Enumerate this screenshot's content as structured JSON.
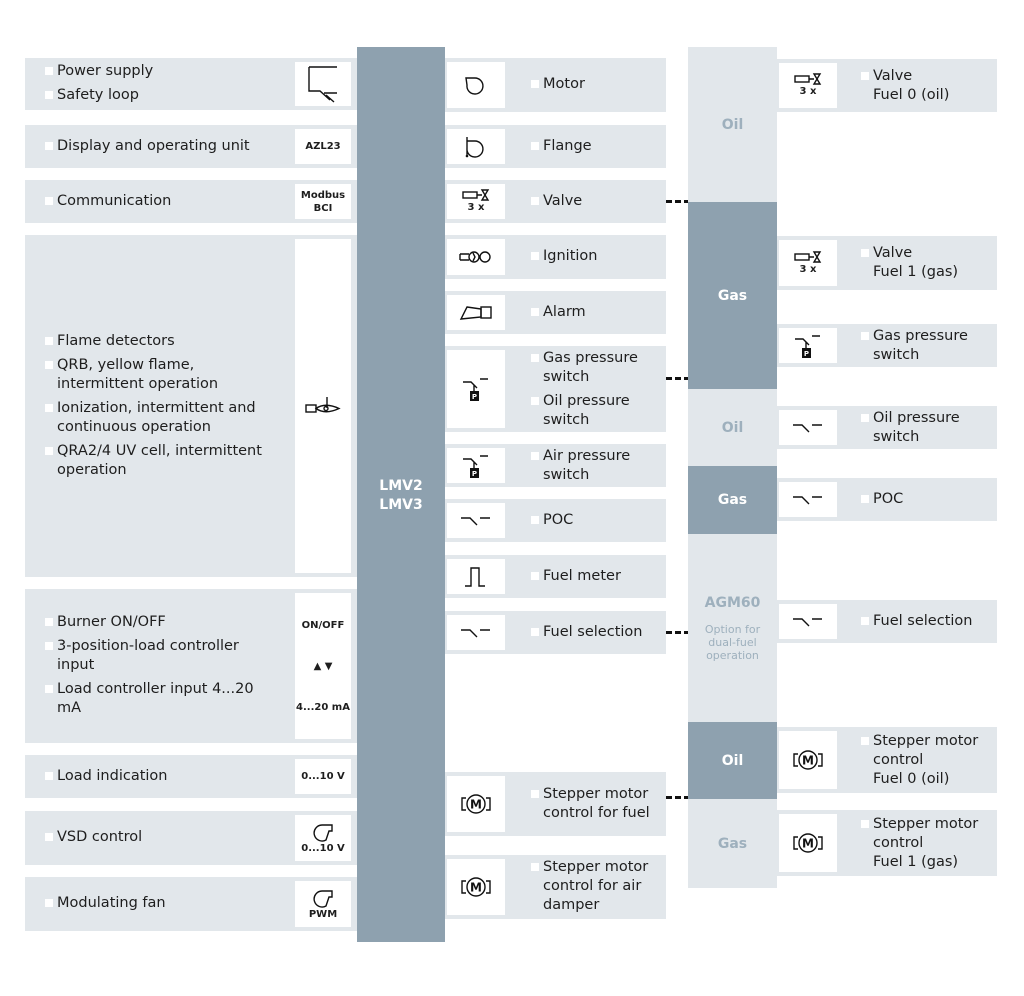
{
  "central_unit": {
    "line1": "LMV2",
    "line2": "LMV3"
  },
  "left": [
    {
      "items": [
        "Power supply",
        "Safety loop"
      ],
      "icon": "safety-loop-icon",
      "icon_text": []
    },
    {
      "items": [
        "Display and operating unit"
      ],
      "icon": "text",
      "icon_text": [
        "AZL23"
      ]
    },
    {
      "items": [
        "Communication"
      ],
      "icon": "text",
      "icon_text": [
        "Modbus",
        "BCI"
      ]
    },
    {
      "items": [
        "Flame detectors",
        "QRB, yellow flame, intermittent operation",
        "Ionization, intermittent and continuous operation",
        "QRA2/4 UV cell, intermittent operation"
      ],
      "icon": "flame-detector-icon",
      "icon_text": []
    },
    {
      "items": [
        "Burner ON/OFF",
        "3-position-load controller input",
        "Load controller input 4...20 mA"
      ],
      "icon": "text",
      "icon_text": [
        "ON/OFF",
        "▲ ▼",
        "4...20 mA"
      ]
    },
    {
      "items": [
        "Load indication"
      ],
      "icon": "text",
      "icon_text": [
        "0...10 V"
      ]
    },
    {
      "items": [
        "VSD control"
      ],
      "icon": "fan-icon",
      "icon_text": [
        "0...10 V"
      ]
    },
    {
      "items": [
        "Modulating fan"
      ],
      "icon": "fan-icon",
      "icon_text": [
        "PWM"
      ]
    }
  ],
  "middle": [
    {
      "items": [
        "Motor"
      ],
      "icon": "motor-icon",
      "icon_text": []
    },
    {
      "items": [
        "Flange"
      ],
      "icon": "flange-icon",
      "icon_text": []
    },
    {
      "items": [
        "Valve"
      ],
      "icon": "valve-icon",
      "icon_text": [
        "3 x"
      ]
    },
    {
      "items": [
        "Ignition"
      ],
      "icon": "ignition-icon",
      "icon_text": []
    },
    {
      "items": [
        "Alarm"
      ],
      "icon": "alarm-icon",
      "icon_text": []
    },
    {
      "items": [
        "Gas pressure switch",
        "Oil pressure switch"
      ],
      "icon": "pressure-switch-icon",
      "icon_text": []
    },
    {
      "items": [
        "Air pressure switch"
      ],
      "icon": "pressure-switch-icon",
      "icon_text": []
    },
    {
      "items": [
        "POC"
      ],
      "icon": "switch-icon",
      "icon_text": []
    },
    {
      "items": [
        "Fuel meter"
      ],
      "icon": "pulse-icon",
      "icon_text": []
    },
    {
      "items": [
        "Fuel selection"
      ],
      "icon": "switch-icon",
      "icon_text": []
    },
    {
      "items": [
        "Stepper motor control for fuel"
      ],
      "icon": "stepper-motor-icon",
      "icon_text": []
    },
    {
      "items": [
        "Stepper motor control for air damper"
      ],
      "icon": "stepper-motor-icon",
      "icon_text": []
    }
  ],
  "agm_column": [
    {
      "label": "Oil",
      "sub": []
    },
    {
      "label": "Gas",
      "sub": []
    },
    {
      "label": "Oil",
      "sub": []
    },
    {
      "label": "Gas",
      "sub": []
    },
    {
      "label": "AGM60",
      "sub": [
        "Option for",
        "dual-fuel",
        "operation"
      ]
    },
    {
      "label": "Oil",
      "sub": []
    },
    {
      "label": "Gas",
      "sub": []
    }
  ],
  "right": [
    {
      "items": [
        "Valve\nFuel 0 (oil)"
      ],
      "icon": "valve-icon",
      "icon_text": [
        "3 x"
      ]
    },
    {
      "items": [
        "Valve\nFuel 1 (gas)"
      ],
      "icon": "valve-icon",
      "icon_text": [
        "3 x"
      ]
    },
    {
      "items": [
        "Gas pressure switch"
      ],
      "icon": "pressure-switch-icon",
      "icon_text": []
    },
    {
      "items": [
        "Oil pressure switch"
      ],
      "icon": "switch-icon",
      "icon_text": []
    },
    {
      "items": [
        "POC"
      ],
      "icon": "switch-icon",
      "icon_text": []
    },
    {
      "items": [
        "Fuel selection"
      ],
      "icon": "switch-icon",
      "icon_text": []
    },
    {
      "items": [
        "Stepper motor control\nFuel 0 (oil)"
      ],
      "icon": "stepper-motor-icon",
      "icon_text": []
    },
    {
      "items": [
        "Stepper motor control\nFuel 1 (gas)"
      ],
      "icon": "stepper-motor-icon",
      "icon_text": []
    }
  ]
}
